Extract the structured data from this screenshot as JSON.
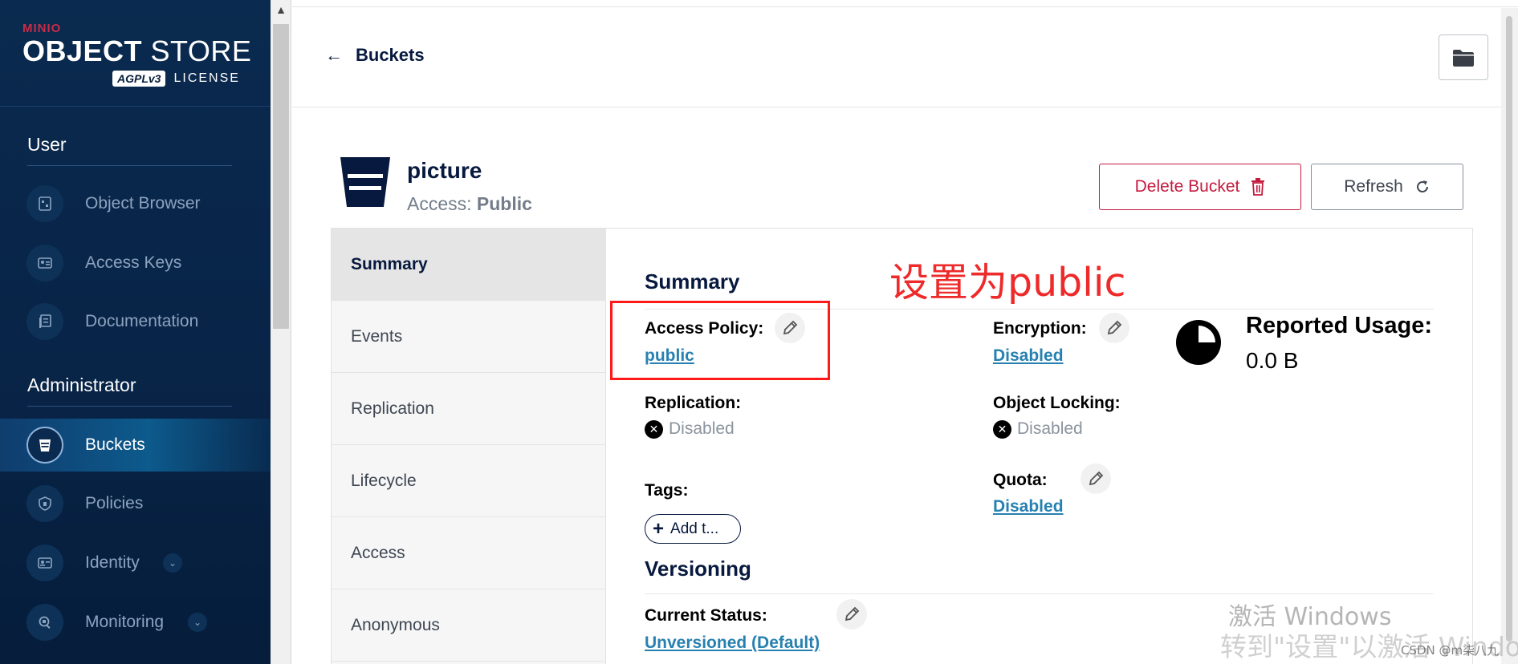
{
  "brand": {
    "logo_top": "MINIO",
    "product_bold": "OBJECT",
    "product_rest": " STORE",
    "license_badge": "AGPLv3",
    "license_label": "LICENSE"
  },
  "sidebar": {
    "user_section": "User",
    "admin_section": "Administrator",
    "user_items": [
      {
        "label": "Object Browser",
        "icon": "object-browser-icon"
      },
      {
        "label": "Access Keys",
        "icon": "access-keys-icon"
      },
      {
        "label": "Documentation",
        "icon": "documentation-icon"
      }
    ],
    "admin_items": [
      {
        "label": "Buckets",
        "icon": "bucket-icon",
        "active": true
      },
      {
        "label": "Policies",
        "icon": "shield-icon"
      },
      {
        "label": "Identity",
        "icon": "identity-icon",
        "expandable": true
      },
      {
        "label": "Monitoring",
        "icon": "monitoring-icon",
        "expandable": true
      }
    ]
  },
  "header": {
    "back_label": "Buckets"
  },
  "bucket": {
    "name": "picture",
    "access_label": "Access: ",
    "access_value": "Public",
    "delete_label": "Delete Bucket",
    "refresh_label": "Refresh"
  },
  "tabs": [
    "Summary",
    "Events",
    "Replication",
    "Lifecycle",
    "Access",
    "Anonymous"
  ],
  "summary": {
    "title": "Summary",
    "annotation": "设置为public",
    "access_policy_label": "Access Policy:",
    "access_policy_value": "public",
    "encryption_label": "Encryption:",
    "encryption_value": "Disabled",
    "replication_label": "Replication:",
    "replication_value": "Disabled",
    "object_locking_label": "Object Locking:",
    "object_locking_value": "Disabled",
    "tags_label": "Tags:",
    "add_tag_label": "Add t...",
    "quota_label": "Quota:",
    "quota_value": "Disabled",
    "usage_label": "Reported Usage:",
    "usage_value": "0.0 B"
  },
  "versioning": {
    "title": "Versioning",
    "status_label": "Current Status:",
    "status_value": "Unversioned (Default)"
  },
  "watermark": {
    "activate": "激活 Windows",
    "activate_sub": "转到\"设置\"以激活 Windows。",
    "csdn": "CSDN @m柒八九"
  },
  "colors": {
    "sidebar_bg": "#082447",
    "accent_navy": "#07193e",
    "link_blue": "#2781b0",
    "danger_red": "#c51b3f",
    "annotation_red": "#ee2a2a"
  }
}
